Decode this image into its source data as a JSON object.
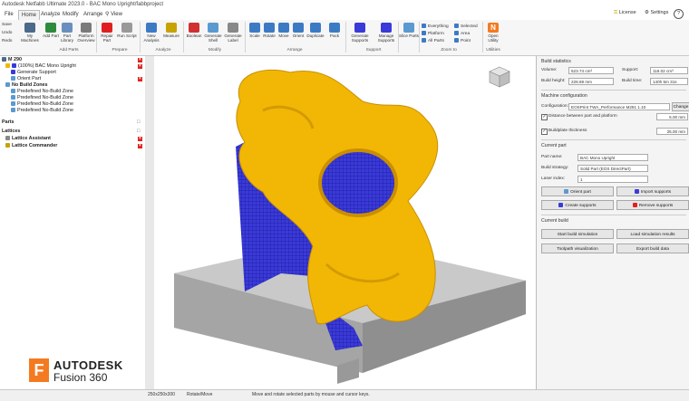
{
  "window": {
    "title": "Autodesk Netfabb Ultimate 2023.0 - BAC Mono Upright/fabbproject"
  },
  "header": {
    "tabs": [
      {
        "label": "File"
      },
      {
        "label": "Home"
      },
      {
        "label": "Analyze"
      },
      {
        "label": "Modify"
      },
      {
        "label": "Arrange"
      },
      {
        "label": "View"
      }
    ],
    "active_tab": "Home",
    "license_label": "License",
    "settings_label": "Settings"
  },
  "ribbon": {
    "left_menu": {
      "save": "Save",
      "undo": "Undo",
      "redo": "Redo"
    },
    "buttons": {
      "my_machines": "My Machines",
      "add_part": "Add Part",
      "part_library": "Part Library",
      "platform_overview": "Platform Overview",
      "repair_part": "Repair Part",
      "run_script": "Run Script",
      "new_analysis": "New Analysis",
      "measure": "Measure",
      "boolean": "Boolean",
      "generate_shell": "Generate Shell",
      "generate_label": "Generate Label",
      "scale": "Scale",
      "rotate": "Rotate",
      "move": "Move",
      "orient": "Orient",
      "duplicate": "Duplicate",
      "pack": "Pack",
      "generate_supports": "Generate Supports",
      "manage_supports": "Manage Supports",
      "slice_parts": "Slice Parts",
      "open_utility": "Open Utility"
    },
    "zoom": {
      "everything": "Everything",
      "platform": "Platform",
      "all_parts": "All Parts",
      "selected": "Selected",
      "area": "Area",
      "point": "Point"
    },
    "groups": {
      "add_parts": "Add Parts",
      "prepare": "Prepare",
      "analyze": "Analyze",
      "modify": "Modify",
      "arrange": "Arrange",
      "support": "Support",
      "zoom_to": "Zoom to",
      "utilities": "Utilities"
    }
  },
  "tree": {
    "machine": "M 290",
    "part": "(100%) BAC Mono Upright",
    "generate_support": "Generate Support",
    "orient_part": "Orient Part",
    "no_build_zones": "No Build Zones",
    "zones": [
      "Predefined No-Build Zone",
      "Predefined No-Build Zone",
      "Predefined No-Build Zone",
      "Predefined No-Build Zone"
    ],
    "parts": "Parts",
    "lattices": "Lattices",
    "lattice_assistant": "Lattice Assistant",
    "lattice_commander": "Lattice Commander"
  },
  "panel": {
    "build_statistics": "Build statistics",
    "volume_label": "Volume:",
    "volume_value": "523.74 cm³",
    "support_label": "Support:",
    "support_value": "116.02 cm³",
    "build_height_label": "Build height:",
    "build_height_value": "228.69 mm",
    "build_time_label": "Build time:",
    "build_time_value": "140h 5m 31s",
    "machine_configuration": "Machine configuration",
    "configuration_label": "Configuration:",
    "configuration_value": "EOSPrint TWA_Performance M291 1.10",
    "change_label": "Change",
    "distance_label": "Distance between part and platform",
    "distance_value": "5.00 mm",
    "buildplate_label": "Buildplate thickness",
    "buildplate_value": "25.00 mm",
    "current_part": "Current part",
    "part_name_label": "Part name:",
    "part_name_value": "BAC Mono Upright",
    "build_strategy_label": "Build strategy:",
    "build_strategy_value": "Solid Part (EOS DirectPart)",
    "laser_index_label": "Laser index:",
    "laser_index_value": "1",
    "orient_part_btn": "Orient part",
    "import_supports_btn": "Import supports",
    "create_supports_btn": "Create supports",
    "remove_supports_btn": "Remove supports",
    "current_build": "Current build",
    "start_build_sim_btn": "Start build simulation",
    "load_sim_results_btn": "Load simulation results",
    "toolpath_vis_btn": "Toolpath visualization",
    "export_build_data_btn": "Export build data"
  },
  "status": {
    "dims": "250x250x300",
    "mode": "Rotate/Move",
    "hint": "Move and rotate selected parts by mouse and cursor keys."
  },
  "branding": {
    "word1": "AUTODESK",
    "word2": "Fusion 360",
    "letter": "F"
  },
  "colors": {
    "part": "#f2b705",
    "support": "#3a3ad8",
    "platform": "#b9b9b9",
    "accent": "#f47a20"
  }
}
